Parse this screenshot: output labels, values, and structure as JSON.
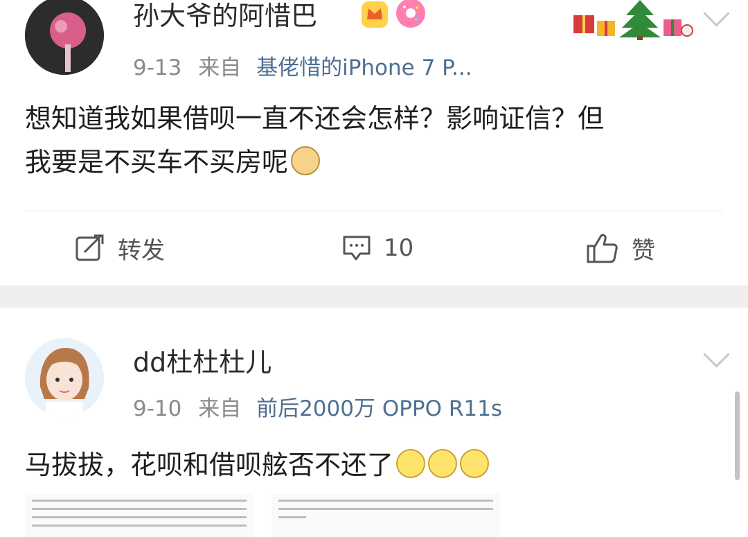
{
  "posts": [
    {
      "username": "孙大爷的阿惜巴",
      "date": "9-13",
      "from_label": "来自",
      "source": "基佬惜的iPhone 7 P...",
      "content_lines": [
        "想知道我如果借呗一直不还会怎样？影响证信？但",
        "我要是不买车不买房呢"
      ],
      "actions": {
        "repost": "转发",
        "comments": "10",
        "like": "赞"
      }
    },
    {
      "username": "dd杜杜杜儿",
      "date": "9-10",
      "from_label": "来自",
      "source": "前后2000万 OPPO R11s",
      "content": "马拔拔，花呗和借呗舷否不还了"
    }
  ],
  "colors": {
    "accent": "#4d6f91",
    "meta": "#8a8a8a",
    "separator": "#eeeeee"
  },
  "icons": [
    "crown-badge-icon",
    "donut-badge-icon",
    "christmas-tree-decoration",
    "doge-emoji",
    "grin-emoji",
    "repost-icon",
    "comment-icon",
    "like-icon",
    "chevron-down-icon"
  ]
}
